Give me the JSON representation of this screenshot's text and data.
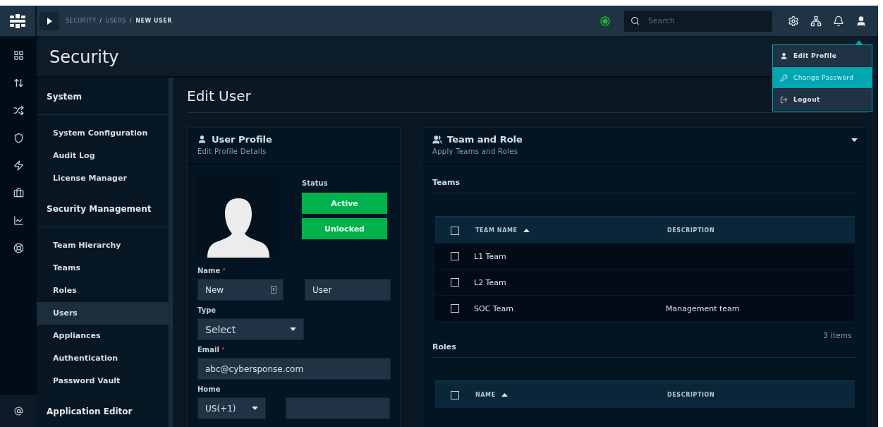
{
  "topbar": {
    "breadcrumb": [
      {
        "label": "SECURITY",
        "current": false
      },
      {
        "label": "USERS",
        "current": false
      },
      {
        "label": "NEW USER",
        "current": true
      }
    ],
    "separators": [
      "/",
      "/"
    ],
    "search": {
      "placeholder": "Search"
    }
  },
  "user_menu": {
    "items": [
      {
        "kind": "profile",
        "label": "Edit Profile",
        "selected": false
      },
      {
        "kind": "password",
        "label": "Change Password",
        "selected": true
      },
      {
        "kind": "logout",
        "label": "Logout",
        "selected": false
      }
    ]
  },
  "page_title": "Security",
  "sidebar": {
    "sections": [
      {
        "title": "System",
        "items": [
          {
            "label": "System Configuration",
            "selected": false
          },
          {
            "label": "Audit Log",
            "selected": false
          },
          {
            "label": "License Manager",
            "selected": false
          }
        ]
      },
      {
        "title": "Security Management",
        "items": [
          {
            "label": "Team Hierarchy",
            "selected": false
          },
          {
            "label": "Teams",
            "selected": false
          },
          {
            "label": "Roles",
            "selected": false
          },
          {
            "label": "Users",
            "selected": true
          },
          {
            "label": "Appliances",
            "selected": false
          },
          {
            "label": "Authentication",
            "selected": false
          },
          {
            "label": "Password Vault",
            "selected": false
          }
        ]
      },
      {
        "title": "Application Editor"
      }
    ]
  },
  "heading": "Edit User",
  "profile": {
    "title": "User Profile",
    "subtitle": "Edit Profile Details",
    "status_label": "Status",
    "status_buttons": [
      {
        "label": "Active",
        "on": true
      },
      {
        "label": "Unlocked",
        "on": true
      }
    ],
    "name_label": "Name",
    "name_required_mark": "•",
    "first_name": "New",
    "last_name": "User",
    "type_label": "Type",
    "type_value": "Select",
    "email_label": "Email",
    "email_required_mark": "•",
    "email": "abc@cybersponse.com",
    "home_label": "Home",
    "country_code": "US(+1)"
  },
  "team_role": {
    "title": "Team and Role",
    "subtitle": "Apply Teams and Roles",
    "teams": {
      "label": "Teams",
      "all_checked": false,
      "columns": [
        "TEAM NAME",
        "DESCRIPTION"
      ],
      "rows": [
        {
          "name": "L1 Team",
          "checked": false
        },
        {
          "name": "L2 Team",
          "checked": false
        },
        {
          "name": "SOC Team",
          "description": "Management team",
          "checked": false
        }
      ],
      "count": "3 items"
    },
    "roles": {
      "label": "Roles",
      "all_checked": false,
      "columns": [
        "NAME",
        "DESCRIPTION"
      ]
    }
  }
}
